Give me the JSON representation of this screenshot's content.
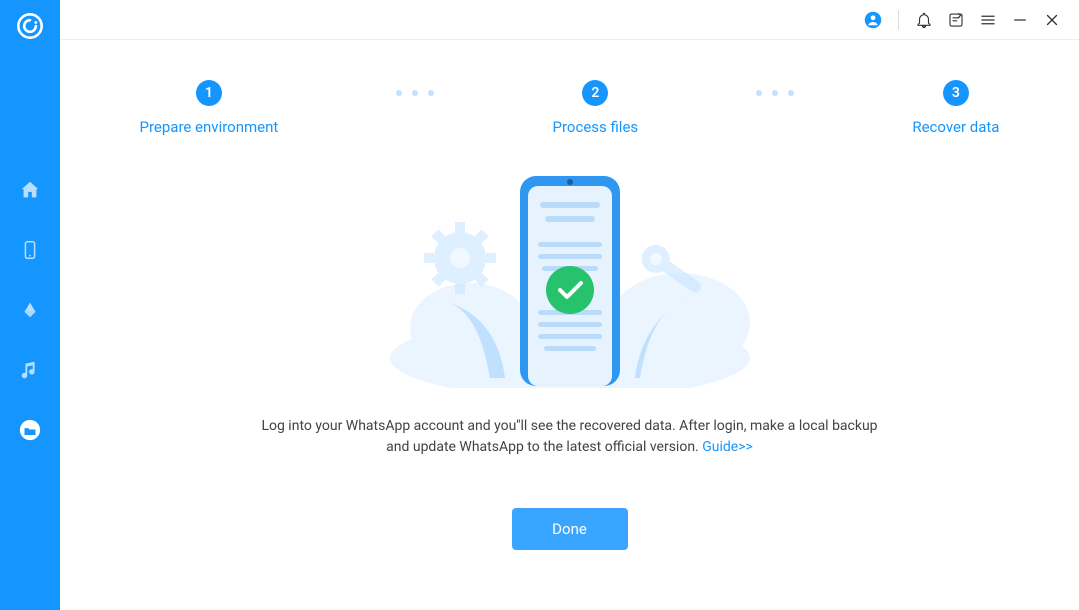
{
  "sidebar": {
    "items": [
      {
        "name": "home",
        "active": false
      },
      {
        "name": "device",
        "active": false
      },
      {
        "name": "cloud",
        "active": false
      },
      {
        "name": "music",
        "active": false
      },
      {
        "name": "folder",
        "active": true
      }
    ]
  },
  "steps": {
    "s1": {
      "num": "1",
      "label": "Prepare environment"
    },
    "s2": {
      "num": "2",
      "label": "Process files"
    },
    "s3": {
      "num": "3",
      "label": "Recover data"
    }
  },
  "instruction": {
    "text1": "Log into your WhatsApp account and you''ll see the recovered data. After login, make a local backup and update WhatsApp to the latest official version. ",
    "link": "Guide>>"
  },
  "done_label": "Done",
  "colors": {
    "accent": "#1596ff",
    "success": "#27c26c"
  }
}
